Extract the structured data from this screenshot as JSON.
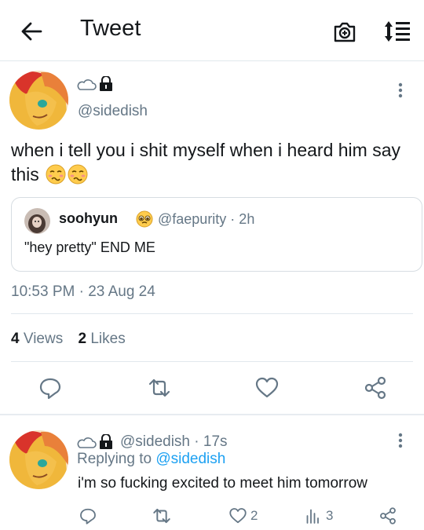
{
  "header": {
    "title": "Tweet"
  },
  "tweet": {
    "handle": "@sidedish",
    "text": "when i tell you i shit myself when i heard him say this",
    "timestamp": "10:53 PM · 23 Aug 24",
    "stats": {
      "views_count": "4",
      "views_label": "Views",
      "likes_count": "2",
      "likes_label": "Likes"
    }
  },
  "quote": {
    "name": "soohyun",
    "meta": "@faepurity · 2h",
    "text": "\"hey pretty\" END ME"
  },
  "reply": {
    "meta": "@sidedish · 17s",
    "replying_prefix": "Replying to",
    "replying_handle": "@sidedish",
    "text": "i'm so fucking excited to meet him tomorrow",
    "likes": "2",
    "views": "3"
  },
  "colors": {
    "accent": "#1da1f2",
    "secondary_text": "#657786",
    "divider": "#e1e8ed"
  }
}
